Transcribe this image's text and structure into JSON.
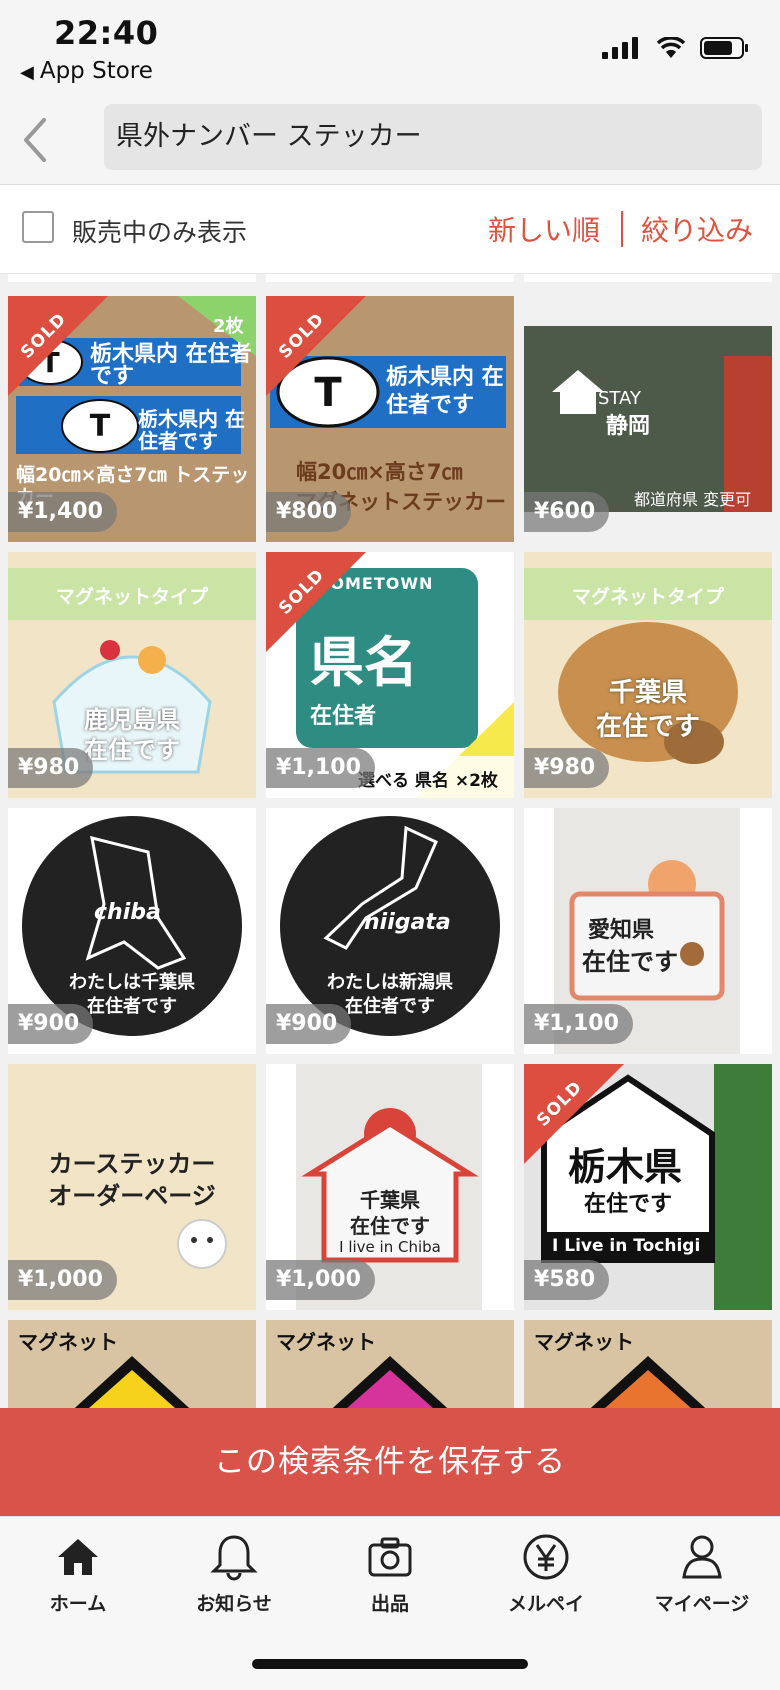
{
  "status_bar": {
    "time": "22:40",
    "back_app": "App Store"
  },
  "search": {
    "query": "県外ナンバー ステッカー"
  },
  "filter": {
    "on_sale_only_label": "販売中のみ表示",
    "on_sale_only_checked": false,
    "sort_label": "新しい順",
    "filter_label": "絞り込み"
  },
  "colors": {
    "accent": "#e0523f",
    "banner": "#d8544a",
    "sold": "#dc4e3f"
  },
  "items": [
    {
      "price": "¥1,400",
      "sold": true,
      "sold_text": "SOLD",
      "image": "tochigi-resident-sticker-2pack",
      "img_lines": [
        "栃木県内 在住者です",
        "栃木県内 在住者です",
        "幅20㎝×高さ7㎝ トステッカー"
      ],
      "badge": "2枚"
    },
    {
      "price": "¥800",
      "sold": true,
      "sold_text": "SOLD",
      "image": "tochigi-resident-magnet",
      "img_lines": [
        "栃木県内 在住者です",
        "幅20㎝×高さ7㎝",
        "マグネットステッカー"
      ],
      "badge": ""
    },
    {
      "price": "¥600",
      "sold": false,
      "sold_text": "",
      "image": "stay-shizuoka-car-window",
      "img_lines": [
        "STAY",
        "静岡",
        "都道府県 変更可"
      ],
      "badge": ""
    },
    {
      "price": "¥980",
      "sold": false,
      "sold_text": "",
      "image": "kagoshima-shaved-ice-magnet",
      "img_lines": [
        "マグネットタイプ",
        "鹿児島県",
        "在住です"
      ],
      "badge": ""
    },
    {
      "price": "¥1,100",
      "sold": true,
      "sold_text": "SOLD",
      "image": "hometown-prefecture-sticker",
      "img_lines": [
        "HOMETOWN",
        "県名",
        "在住者",
        "選べる 県名 ×2枚"
      ],
      "badge": ""
    },
    {
      "price": "¥980",
      "sold": false,
      "sold_text": "",
      "image": "chiba-peanut-magnet",
      "img_lines": [
        "マグネットタイプ",
        "千葉県",
        "在住です"
      ],
      "badge": ""
    },
    {
      "price": "¥900",
      "sold": false,
      "sold_text": "",
      "image": "chiba-carbon-circle",
      "img_lines": [
        "chiba",
        "わたしは千葉県",
        "在住者です"
      ],
      "badge": ""
    },
    {
      "price": "¥900",
      "sold": false,
      "sold_text": "",
      "image": "niigata-carbon-circle",
      "img_lines": [
        "niigata",
        "わたしは新潟県",
        "在住者です"
      ],
      "badge": ""
    },
    {
      "price": "¥1,100",
      "sold": false,
      "sold_text": "",
      "image": "aichi-bear-house-sign",
      "img_lines": [
        "愛知県",
        "在住です"
      ],
      "badge": ""
    },
    {
      "price": "¥1,000",
      "sold": false,
      "sold_text": "",
      "image": "car-sticker-order-page",
      "img_lines": [
        "カーステッカー",
        "オーダーページ"
      ],
      "badge": ""
    },
    {
      "price": "¥1,000",
      "sold": false,
      "sold_text": "",
      "image": "chiba-house-sign",
      "img_lines": [
        "千葉県",
        "在住です",
        "I live in Chiba"
      ],
      "badge": ""
    },
    {
      "price": "¥580",
      "sold": true,
      "sold_text": "SOLD",
      "image": "tochigi-house-sticker",
      "img_lines": [
        "栃木県",
        "在住です",
        "I Live in Tochigi"
      ],
      "badge": ""
    },
    {
      "price": "",
      "sold": false,
      "sold_text": "",
      "image": "magnet-yellow",
      "img_lines": [
        "マグネット"
      ],
      "badge": ""
    },
    {
      "price": "",
      "sold": false,
      "sold_text": "",
      "image": "magnet-pink",
      "img_lines": [
        "マグネット"
      ],
      "badge": ""
    },
    {
      "price": "",
      "sold": false,
      "sold_text": "",
      "image": "magnet-orange",
      "img_lines": [
        "マグネット"
      ],
      "badge": ""
    }
  ],
  "save_search_label": "この検索条件を保存する",
  "tabs": [
    {
      "label": "ホーム",
      "icon": "home-icon"
    },
    {
      "label": "お知らせ",
      "icon": "bell-icon"
    },
    {
      "label": "出品",
      "icon": "camera-icon"
    },
    {
      "label": "メルペイ",
      "icon": "yen-icon"
    },
    {
      "label": "マイページ",
      "icon": "person-icon"
    }
  ]
}
